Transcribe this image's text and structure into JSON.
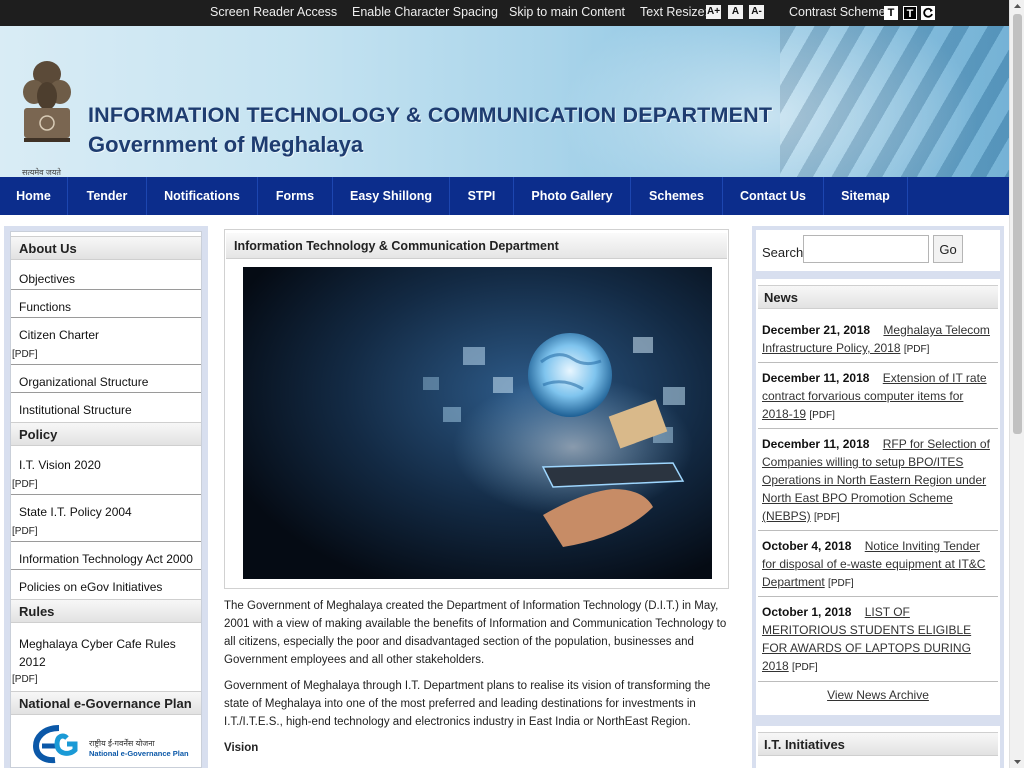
{
  "topbar": {
    "screen_reader": "Screen Reader Access",
    "char_spacing": "Enable Character Spacing",
    "skip": "Skip to main Content",
    "text_resize_label": "Text Resize:",
    "resize_buttons": [
      "A+",
      "A",
      "A-"
    ],
    "contrast_label": "Contrast Scheme:",
    "contrast_buttons": [
      "T",
      "T"
    ]
  },
  "header": {
    "title": "INFORMATION TECHNOLOGY & COMMUNICATION DEPARTMENT",
    "subtitle": "Government of Meghalaya",
    "emblem_motto": "सत्यमेव जयते"
  },
  "nav": {
    "items": [
      "Home",
      "Tender",
      "Notifications",
      "Forms",
      "Easy Shillong",
      "STPI",
      "Photo Gallery",
      "Schemes",
      "Contact Us",
      "Sitemap"
    ]
  },
  "sidebar": {
    "about_title": "About Us",
    "about_items": [
      "Objectives",
      "Functions",
      "Citizen Charter",
      "Organizational Structure",
      "Institutional Structure"
    ],
    "policy_title": "Policy",
    "policy_items": [
      "I.T. Vision 2020",
      "State I.T. Policy 2004",
      "Information Technology Act 2000",
      "Policies on eGov Initiatives"
    ],
    "rules_title": "Rules",
    "rules_items": [
      "Meghalaya Cyber Cafe Rules 2012"
    ],
    "pdf_tag": "[PDF]",
    "negp_title": "National e-Governance Plan",
    "negp_logo_hindi": "राष्ट्रीय ई-गवर्नेंस योजना",
    "negp_logo_english": "National e-Governance Plan"
  },
  "main": {
    "heading": "Information Technology & Communication Department",
    "para1": "The Government of Meghalaya created the Department of Information Technology (D.I.T.) in May, 2001 with a view of making available the benefits of Information and Communication Technology to all citizens, especially the poor and disadvantaged section of the population, businesses and Government employees and all other stakeholders.",
    "para2": "Government of Meghalaya through I.T. Department plans to realise its vision of transforming the state of Meghalaya into one of the most preferred and leading destinations for investments in I.T./I.T.E.S., high-end technology and electronics industry in East India or NorthEast Region.",
    "vision_label": "Vision"
  },
  "right": {
    "search_label": "Search",
    "search_value": "",
    "go_label": "Go",
    "news_title": "News",
    "news": [
      {
        "date": "December 21, 2018",
        "text": "Meghalaya Telecom Infrastructure Policy, 2018",
        "tag": "[PDF]"
      },
      {
        "date": "December 11, 2018",
        "text": "Extension of IT rate contract forvarious computer items for 2018-19",
        "tag": "[PDF]"
      },
      {
        "date": "December 11, 2018",
        "text": "RFP for Selection of Companies willing to setup BPO/ITES Operations in North Eastern Region under North East BPO Promotion Scheme (NEBPS)",
        "tag": "[PDF]"
      },
      {
        "date": "October 4, 2018",
        "text": "Notice Inviting Tender for disposal of e-waste equipment at IT&C Department",
        "tag": "[PDF]"
      },
      {
        "date": "October 1, 2018",
        "text": "LIST OF MERITORIOUS STUDENTS ELIGIBLE FOR AWARDS OF LAPTOPS DURING 2018",
        "tag": "[PDF]"
      }
    ],
    "archive_label": "View News Archive",
    "initiatives_title": "I.T. Initiatives"
  }
}
